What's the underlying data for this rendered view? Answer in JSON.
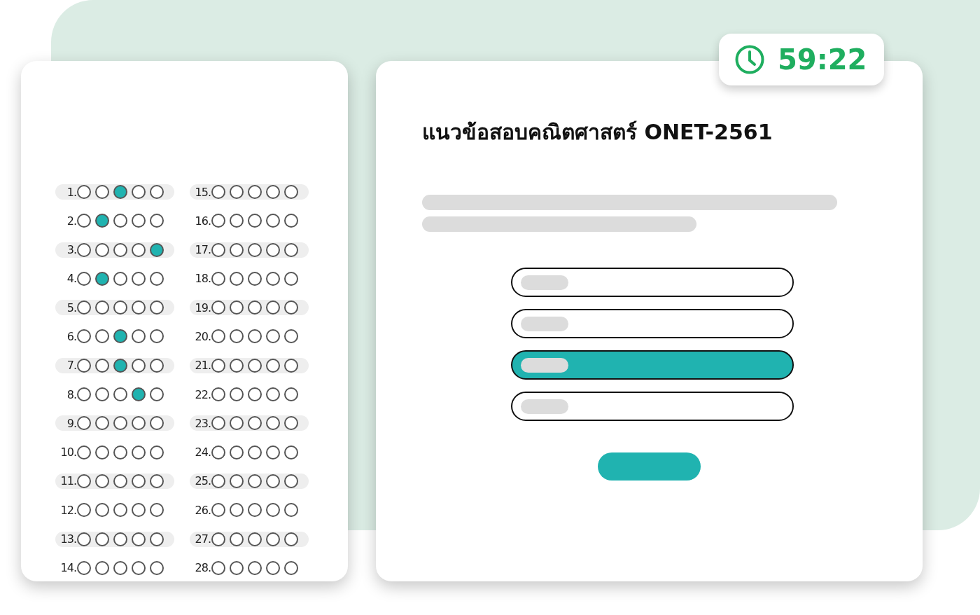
{
  "answer_sheet": {
    "columns": [
      {
        "questions": [
          {
            "number": "1.",
            "choices": [
              {
                "selected": false
              },
              {
                "selected": false
              },
              {
                "selected": true
              },
              {
                "selected": false
              },
              {
                "selected": false
              }
            ]
          },
          {
            "number": "2.",
            "choices": [
              {
                "selected": false
              },
              {
                "selected": true
              },
              {
                "selected": false
              },
              {
                "selected": false
              },
              {
                "selected": false
              }
            ]
          },
          {
            "number": "3.",
            "choices": [
              {
                "selected": false
              },
              {
                "selected": false
              },
              {
                "selected": false
              },
              {
                "selected": false
              },
              {
                "selected": true
              }
            ]
          },
          {
            "number": "4.",
            "choices": [
              {
                "selected": false
              },
              {
                "selected": true
              },
              {
                "selected": false
              },
              {
                "selected": false
              },
              {
                "selected": false
              }
            ]
          },
          {
            "number": "5.",
            "choices": [
              {
                "selected": false
              },
              {
                "selected": false
              },
              {
                "selected": false
              },
              {
                "selected": false
              },
              {
                "selected": false
              }
            ]
          },
          {
            "number": "6.",
            "choices": [
              {
                "selected": false
              },
              {
                "selected": false
              },
              {
                "selected": true
              },
              {
                "selected": false
              },
              {
                "selected": false
              }
            ]
          },
          {
            "number": "7.",
            "choices": [
              {
                "selected": false
              },
              {
                "selected": false
              },
              {
                "selected": true
              },
              {
                "selected": false
              },
              {
                "selected": false
              }
            ]
          },
          {
            "number": "8.",
            "choices": [
              {
                "selected": false
              },
              {
                "selected": false
              },
              {
                "selected": false
              },
              {
                "selected": true
              },
              {
                "selected": false
              }
            ]
          },
          {
            "number": "9.",
            "choices": [
              {
                "selected": false
              },
              {
                "selected": false
              },
              {
                "selected": false
              },
              {
                "selected": false
              },
              {
                "selected": false
              }
            ]
          },
          {
            "number": "10.",
            "choices": [
              {
                "selected": false
              },
              {
                "selected": false
              },
              {
                "selected": false
              },
              {
                "selected": false
              },
              {
                "selected": false
              }
            ]
          },
          {
            "number": "11.",
            "choices": [
              {
                "selected": false
              },
              {
                "selected": false
              },
              {
                "selected": false
              },
              {
                "selected": false
              },
              {
                "selected": false
              }
            ]
          },
          {
            "number": "12.",
            "choices": [
              {
                "selected": false
              },
              {
                "selected": false
              },
              {
                "selected": false
              },
              {
                "selected": false
              },
              {
                "selected": false
              }
            ]
          },
          {
            "number": "13.",
            "choices": [
              {
                "selected": false
              },
              {
                "selected": false
              },
              {
                "selected": false
              },
              {
                "selected": false
              },
              {
                "selected": false
              }
            ]
          },
          {
            "number": "14.",
            "choices": [
              {
                "selected": false
              },
              {
                "selected": false
              },
              {
                "selected": false
              },
              {
                "selected": false
              },
              {
                "selected": false
              }
            ]
          }
        ]
      },
      {
        "questions": [
          {
            "number": "15.",
            "choices": [
              {
                "selected": false
              },
              {
                "selected": false
              },
              {
                "selected": false
              },
              {
                "selected": false
              },
              {
                "selected": false
              }
            ]
          },
          {
            "number": "16.",
            "choices": [
              {
                "selected": false
              },
              {
                "selected": false
              },
              {
                "selected": false
              },
              {
                "selected": false
              },
              {
                "selected": false
              }
            ]
          },
          {
            "number": "17.",
            "choices": [
              {
                "selected": false
              },
              {
                "selected": false
              },
              {
                "selected": false
              },
              {
                "selected": false
              },
              {
                "selected": false
              }
            ]
          },
          {
            "number": "18.",
            "choices": [
              {
                "selected": false
              },
              {
                "selected": false
              },
              {
                "selected": false
              },
              {
                "selected": false
              },
              {
                "selected": false
              }
            ]
          },
          {
            "number": "19.",
            "choices": [
              {
                "selected": false
              },
              {
                "selected": false
              },
              {
                "selected": false
              },
              {
                "selected": false
              },
              {
                "selected": false
              }
            ]
          },
          {
            "number": "20.",
            "choices": [
              {
                "selected": false
              },
              {
                "selected": false
              },
              {
                "selected": false
              },
              {
                "selected": false
              },
              {
                "selected": false
              }
            ]
          },
          {
            "number": "21.",
            "choices": [
              {
                "selected": false
              },
              {
                "selected": false
              },
              {
                "selected": false
              },
              {
                "selected": false
              },
              {
                "selected": false
              }
            ]
          },
          {
            "number": "22.",
            "choices": [
              {
                "selected": false
              },
              {
                "selected": false
              },
              {
                "selected": false
              },
              {
                "selected": false
              },
              {
                "selected": false
              }
            ]
          },
          {
            "number": "23.",
            "choices": [
              {
                "selected": false
              },
              {
                "selected": false
              },
              {
                "selected": false
              },
              {
                "selected": false
              },
              {
                "selected": false
              }
            ]
          },
          {
            "number": "24.",
            "choices": [
              {
                "selected": false
              },
              {
                "selected": false
              },
              {
                "selected": false
              },
              {
                "selected": false
              },
              {
                "selected": false
              }
            ]
          },
          {
            "number": "25.",
            "choices": [
              {
                "selected": false
              },
              {
                "selected": false
              },
              {
                "selected": false
              },
              {
                "selected": false
              },
              {
                "selected": false
              }
            ]
          },
          {
            "number": "26.",
            "choices": [
              {
                "selected": false
              },
              {
                "selected": false
              },
              {
                "selected": false
              },
              {
                "selected": false
              },
              {
                "selected": false
              }
            ]
          },
          {
            "number": "27.",
            "choices": [
              {
                "selected": false
              },
              {
                "selected": false
              },
              {
                "selected": false
              },
              {
                "selected": false
              },
              {
                "selected": false
              }
            ]
          },
          {
            "number": "28.",
            "choices": [
              {
                "selected": false
              },
              {
                "selected": false
              },
              {
                "selected": false
              },
              {
                "selected": false
              },
              {
                "selected": false
              }
            ]
          }
        ]
      }
    ]
  },
  "timer": {
    "time": "59:22"
  },
  "question": {
    "title": "แนวข้อสอบคณิตศาสตร์ ONET-2561",
    "options": [
      {
        "selected": false
      },
      {
        "selected": false
      },
      {
        "selected": true
      },
      {
        "selected": false
      }
    ]
  }
}
